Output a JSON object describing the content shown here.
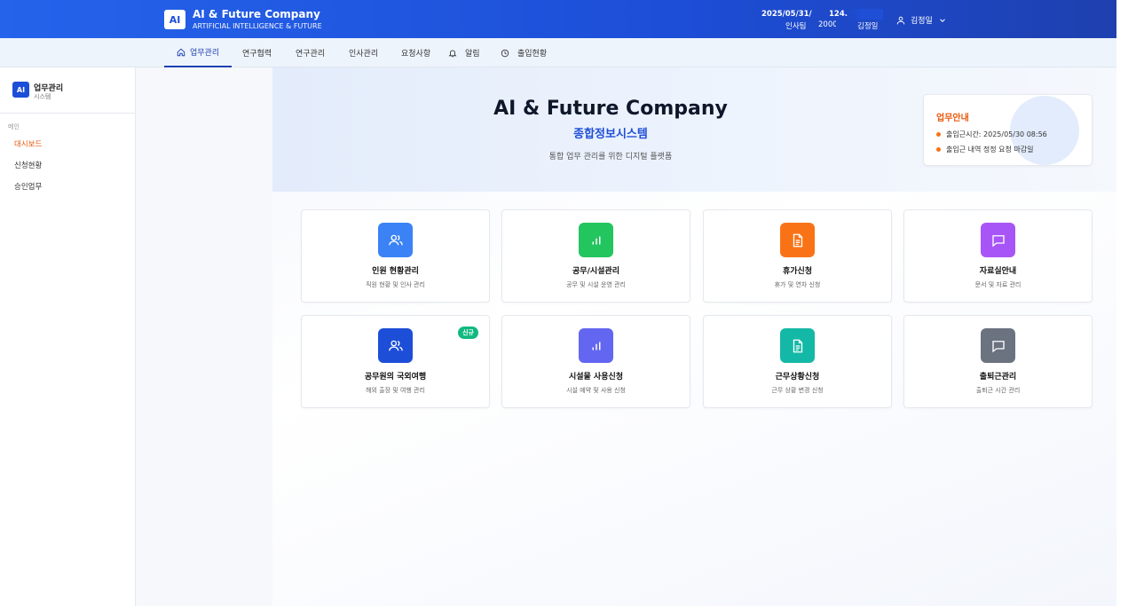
{
  "header": {
    "logo": "AI",
    "title": "AI & Future Company",
    "subtitle": "ARTIFICIAL INTELLIGENCE & FUTURE",
    "date": "2025/05/31/",
    "dept": "인사팀",
    "ip": "124.",
    "emp_id": "2000",
    "name": "김정일",
    "user_name": "김정일"
  },
  "nav": {
    "items": [
      {
        "label": "업무관리",
        "icon": "home-icon"
      },
      {
        "label": "연구협력"
      },
      {
        "label": "연구관리"
      },
      {
        "label": "인사관리"
      },
      {
        "label": "요청사항"
      },
      {
        "label": "알림",
        "icon": "bell-icon"
      },
      {
        "label": "출입현황",
        "icon": "clock-icon"
      }
    ]
  },
  "sidebar": {
    "logo": "AI",
    "title": "업무관리",
    "subtitle": "시스템",
    "section": "메인",
    "items": [
      {
        "label": "대시보드"
      },
      {
        "label": "신청현황"
      },
      {
        "label": "승인업무"
      }
    ]
  },
  "hero": {
    "title": "AI & Future Company",
    "subtitle": "종합정보시스템",
    "description": "통합 업무 관리를 위한 디지털 플랫폼"
  },
  "notice": {
    "title": "업무안내",
    "lines": [
      "출입근시간: 2025/05/30 08:56",
      "출입근 내역 정정 요청 마감일"
    ]
  },
  "cards": [
    {
      "title": "인원 현황관리",
      "desc": "직원 현황 및 인사 관리",
      "icon": "users-icon",
      "color": "#3b82f6"
    },
    {
      "title": "공무/시설관리",
      "desc": "공무 및 시설 운영 관리",
      "icon": "bar-chart-icon",
      "color": "#22c55e"
    },
    {
      "title": "휴가신청",
      "desc": "휴가 및 연차 신청",
      "icon": "document-icon",
      "color": "#f97316"
    },
    {
      "title": "자료실안내",
      "desc": "문서 및 자료 관리",
      "icon": "message-icon",
      "color": "#a855f7"
    },
    {
      "title": "공무원의 국외여행",
      "desc": "해외 출장 및 여행 관리",
      "icon": "users-icon",
      "color": "#1d4ed8",
      "badge": "신규"
    },
    {
      "title": "시설물 사용신청",
      "desc": "시설 예약 및 사용 신청",
      "icon": "bar-chart-icon",
      "color": "#6366f1"
    },
    {
      "title": "근무상황신청",
      "desc": "근무 상황 변경 신청",
      "icon": "document-icon",
      "color": "#14b8a6"
    },
    {
      "title": "출퇴근관리",
      "desc": "출퇴근 시간 관리",
      "icon": "message-icon",
      "color": "#6b7280"
    }
  ]
}
